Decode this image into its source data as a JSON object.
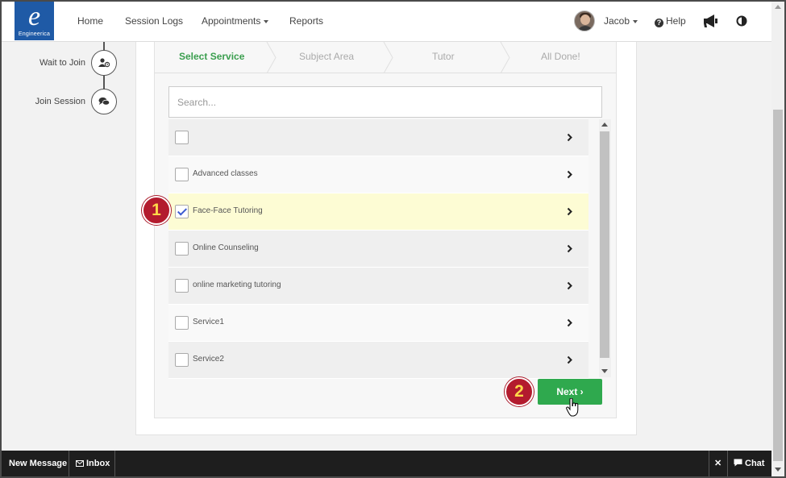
{
  "app": {
    "logo_letter": "e",
    "logo_name": "Engineerica",
    "brand_color": "#1f5aa6",
    "accent_color": "#2fa94e"
  },
  "nav": {
    "home": "Home",
    "session_logs": "Session Logs",
    "appointments": "Appointments",
    "reports": "Reports",
    "user_name": "Jacob",
    "help": "Help",
    "help_glyph": "?",
    "icons": [
      "megaphone-icon",
      "contrast-icon"
    ]
  },
  "stepper": {
    "steps": [
      {
        "label": "Wait to Join",
        "icon": "user-clock-icon"
      },
      {
        "label": "Join Session",
        "icon": "chat-bubbles-icon"
      }
    ]
  },
  "wizard": {
    "tabs": [
      {
        "label": "Select Service",
        "active": true
      },
      {
        "label": "Subject Area",
        "active": false
      },
      {
        "label": "Tutor",
        "active": false
      },
      {
        "label": "All Done!",
        "active": false
      }
    ],
    "search_placeholder": "Search...",
    "services": [
      {
        "label": "",
        "checked": false
      },
      {
        "label": "Advanced classes",
        "checked": false
      },
      {
        "label": "Face-Face Tutoring",
        "checked": true
      },
      {
        "label": "Online Counseling",
        "checked": false
      },
      {
        "label": "online marketing tutoring",
        "checked": false
      },
      {
        "label": "Service1",
        "checked": false
      },
      {
        "label": "Service2",
        "checked": false
      }
    ],
    "next_label": "Next ›"
  },
  "annotations": {
    "marker_1": "1",
    "marker_2": "2",
    "marker_color": "#b31b2e"
  },
  "bottom_bar": {
    "new_message": "New Message",
    "inbox": "Inbox",
    "close": "✕",
    "chat": "Chat"
  }
}
